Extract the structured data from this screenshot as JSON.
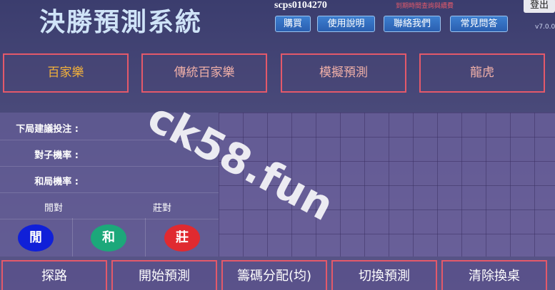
{
  "header": {
    "title": "決勝預測系統",
    "username": "scps0104270",
    "notice": "到期時間查詢與續費",
    "logout_label": "登出",
    "version": "v7.0.0",
    "nav": [
      "購買",
      "使用說明",
      "聯絡我們",
      "常見問答"
    ]
  },
  "modes": [
    {
      "label": "百家樂",
      "active": true
    },
    {
      "label": "傳統百家樂",
      "active": false
    },
    {
      "label": "模擬預測",
      "active": false
    },
    {
      "label": "龍虎",
      "active": false
    }
  ],
  "panel": {
    "next_bet_label": "下局建議投注 :",
    "pair_prob_label": "對子機率 :",
    "tie_prob_label": "和局機率 :",
    "player_pair": "閒對",
    "banker_pair": "莊對",
    "player": "閒",
    "tie": "和",
    "banker": "莊"
  },
  "colors": {
    "player": "#1020d8",
    "tie": "#1ca87a",
    "banker": "#e02a30",
    "accent_border": "#e4596a"
  },
  "watermark": "ck58.fun",
  "actions": [
    "探路",
    "開始預測",
    "籌碼分配(均)",
    "切換預測",
    "清除換桌"
  ]
}
